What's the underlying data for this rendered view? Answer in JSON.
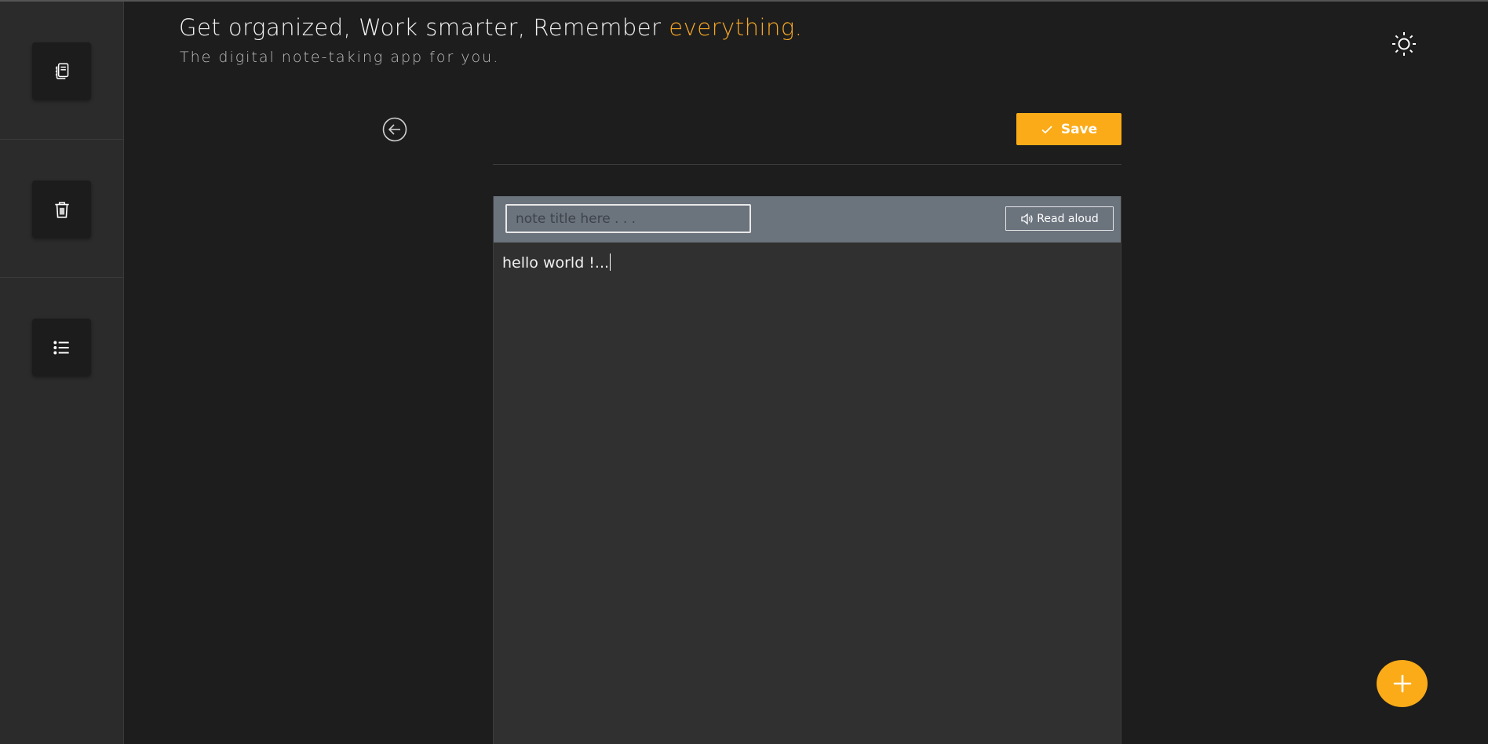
{
  "header": {
    "headline_main": "Get organized, Work smarter, Remember ",
    "headline_accent": "everything.",
    "subheadline": "The digital note-taking app for you."
  },
  "sidebar": {
    "items": [
      {
        "name": "notes",
        "icon": "notebooks-icon"
      },
      {
        "name": "trash",
        "icon": "trash-icon"
      },
      {
        "name": "list",
        "icon": "list-icon"
      }
    ]
  },
  "editor": {
    "save_label": "Save",
    "title_placeholder": "note title here . . .",
    "title_value": "",
    "read_aloud_label": "Read aloud",
    "body_text": "hello world !..."
  },
  "colors": {
    "accent": "#fbab18",
    "background": "#1d1d1d",
    "sidebar": "#2b2b2b",
    "toolbar": "#6b737d"
  },
  "icons": {
    "theme": "sun-icon",
    "back": "arrow-left-circle-icon",
    "save": "check-icon",
    "read": "speaker-icon",
    "fab": "plus-icon"
  }
}
